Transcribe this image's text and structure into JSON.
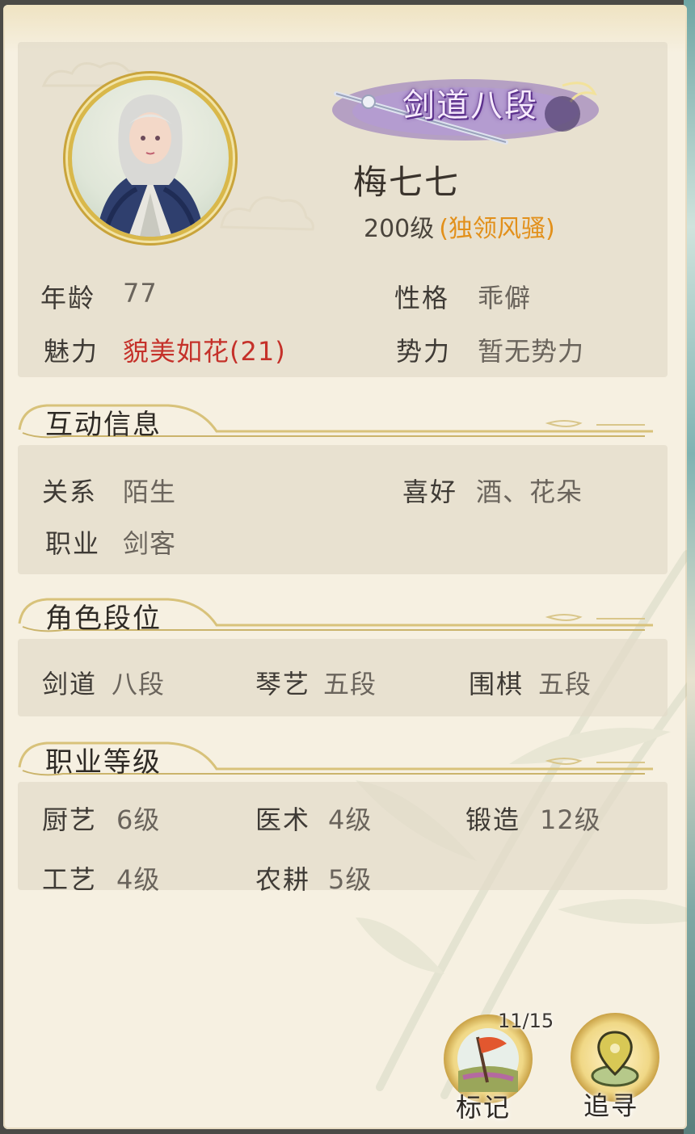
{
  "badge": {
    "text": "剑道八段"
  },
  "profile": {
    "name": "梅七七",
    "level": "200级",
    "level_title": "(独领风骚)"
  },
  "basic": {
    "age_label": "年龄",
    "age_value": "77",
    "personality_label": "性格",
    "personality_value": "乖僻",
    "charm_label": "魅力",
    "charm_value": "貌美如花(21)",
    "faction_label": "势力",
    "faction_value": "暂无势力"
  },
  "interaction": {
    "title": "互动信息",
    "relation_label": "关系",
    "relation_value": "陌生",
    "hobby_label": "喜好",
    "hobby_value": "酒、花朵",
    "occupation_label": "职业",
    "occupation_value": "剑客"
  },
  "rank": {
    "title": "角色段位",
    "items": [
      {
        "label": "剑道",
        "value": "八段"
      },
      {
        "label": "琴艺",
        "value": "五段"
      },
      {
        "label": "围棋",
        "value": "五段"
      }
    ]
  },
  "job": {
    "title": "职业等级",
    "items": [
      {
        "label": "厨艺",
        "value": "6级"
      },
      {
        "label": "医术",
        "value": "4级"
      },
      {
        "label": "锻造",
        "value": "12级"
      },
      {
        "label": "工艺",
        "value": "4级"
      },
      {
        "label": "农耕",
        "value": "5级"
      }
    ]
  },
  "actions": {
    "mark_label": "标记",
    "mark_count": "11/15",
    "seek_label": "追寻"
  },
  "colors": {
    "accent_red": "#c5312a",
    "accent_orange": "#e2901b",
    "gold": "#d9b84a",
    "badge_purple": "#6c3d9c"
  }
}
